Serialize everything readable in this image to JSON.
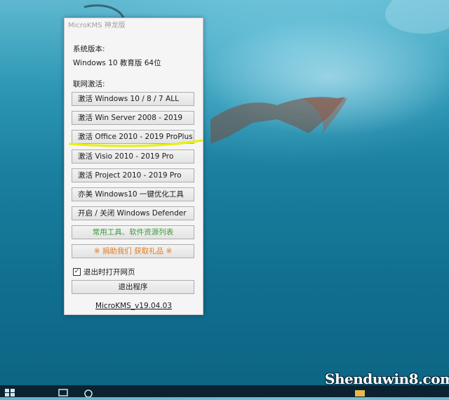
{
  "window": {
    "title": "MicroKMS 神龙版",
    "system_version_label": "系统版本:",
    "system_version_value": "Windows 10 教育版 64位",
    "online_activation_label": "联网激活:",
    "buttons": [
      {
        "label": "激活 Windows 10 / 8 / 7 ALL"
      },
      {
        "label": "激活 Win Server 2008 - 2019"
      },
      {
        "label": "激活 Office 2010 - 2019 ProPlus"
      },
      {
        "label": "激活 Visio 2010 - 2019 Pro"
      },
      {
        "label": "激活 Project 2010 - 2019 Pro"
      },
      {
        "label": "亦美 Windows10 一键优化工具"
      },
      {
        "label": "开启 / 关闭 Windows Defender"
      },
      {
        "label": "常用工具、软件资源列表"
      },
      {
        "label": "※ 捐助我们 获取礼品 ※"
      }
    ],
    "open_page_on_exit": {
      "label": "退出时打开网页",
      "checked": true
    },
    "exit_button": "退出程序",
    "version_link": "MicroKMS_v19.04.03"
  },
  "watermark": "Shenduwin8.com",
  "colors": {
    "highlight_stroke": "#e8f000",
    "green_text": "#3f9a3f",
    "orange_text": "#e07a1f"
  }
}
